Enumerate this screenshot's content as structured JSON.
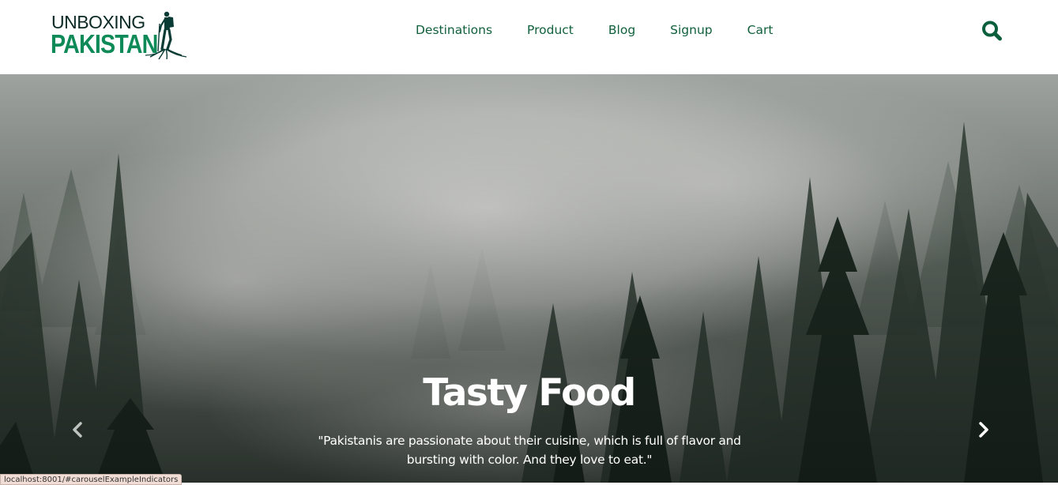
{
  "brand": {
    "line1": "UNBOXING",
    "line2": "PAKISTAN",
    "icon": "hiker-logo-icon",
    "colors": {
      "dark": "#0b2a25",
      "green": "#0d8a58"
    }
  },
  "nav": {
    "items": [
      {
        "label": "Destinations"
      },
      {
        "label": "Product"
      },
      {
        "label": "Blog"
      },
      {
        "label": "Signup"
      },
      {
        "label": "Cart"
      }
    ],
    "link_color": "#11603c",
    "search_icon": "search-icon"
  },
  "carousel": {
    "background": "misty-pine-forest-photo",
    "caption": {
      "title": "Tasty Food",
      "text": "\"Pakistanis are passionate about their cuisine, which is full of flavor and bursting with color. And they love to eat.\""
    },
    "prev_icon": "chevron-left-icon",
    "next_icon": "chevron-right-icon"
  },
  "status_bar": {
    "url": "localhost:8001/#carouselExampleIndicators"
  }
}
